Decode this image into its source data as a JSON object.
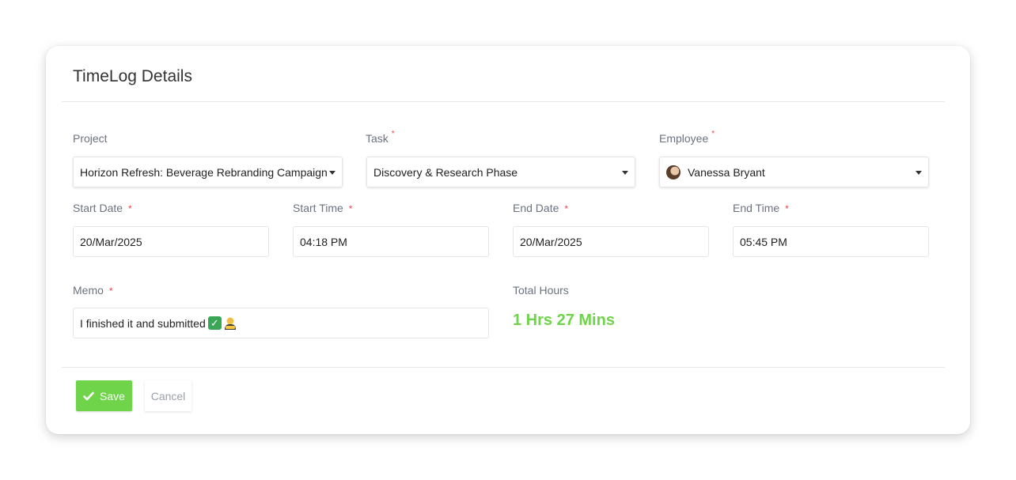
{
  "card": {
    "title": "TimeLog Details"
  },
  "fields": {
    "project": {
      "label": "Project",
      "value": "Horizon Refresh: Beverage Rebranding Campaign"
    },
    "task": {
      "label": "Task",
      "required": "*",
      "value": "Discovery & Research Phase"
    },
    "employee": {
      "label": "Employee",
      "required": "*",
      "value": "Vanessa Bryant"
    },
    "start_date": {
      "label": "Start Date",
      "required": "*",
      "value": "20/Mar/2025"
    },
    "start_time": {
      "label": "Start Time",
      "required": "*",
      "value": "04:18 PM"
    },
    "end_date": {
      "label": "End Date",
      "required": "*",
      "value": "20/Mar/2025"
    },
    "end_time": {
      "label": "End Time",
      "required": "*",
      "value": "05:45 PM"
    },
    "memo": {
      "label": "Memo",
      "required": "*",
      "value": "I finished it and submitted"
    },
    "total_hours": {
      "label": "Total Hours",
      "value": "1 Hrs 27 Mins"
    }
  },
  "actions": {
    "save_label": "Save",
    "cancel_label": "Cancel"
  },
  "colors": {
    "accent": "#6fd44a",
    "required": "#ef4444"
  },
  "icons": {
    "save": "check-icon",
    "dropdown": "caret-down-icon",
    "memo_emojis": [
      "check-mark-button-emoji",
      "person-bowing-emoji"
    ]
  }
}
